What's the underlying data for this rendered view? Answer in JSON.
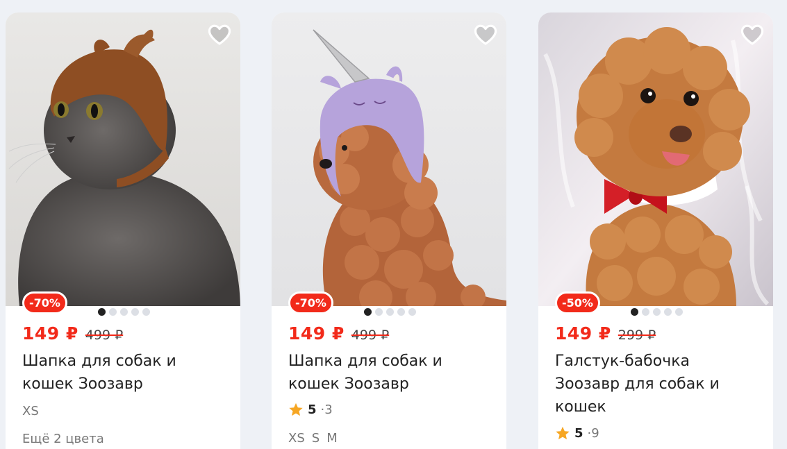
{
  "products": [
    {
      "discount": "-70%",
      "price": "149 ₽",
      "old_price": "499 ₽",
      "title_lines": [
        "Шапка для собак и",
        "кошек Зоозавр"
      ],
      "size": "XS",
      "colors_more": "Ещё 2 цвета",
      "photo_alt": "cat-in-reindeer-hat"
    },
    {
      "discount": "-70%",
      "price": "149 ₽",
      "old_price": "499 ₽",
      "title_lines": [
        "Шапка для собак и",
        "кошек Зоозавр"
      ],
      "rating": "5",
      "rating_sep": "·",
      "reviews": "3",
      "sizes": [
        "XS",
        "S",
        "M"
      ],
      "photo_alt": "poodle-in-unicorn-hat"
    },
    {
      "discount": "-50%",
      "price": "149 ₽",
      "old_price": "299 ₽",
      "title_lines": [
        "Галстук-бабочка",
        "Зоозавр для собак и",
        "кошек"
      ],
      "rating": "5",
      "rating_sep": "·",
      "reviews": "9",
      "photo_alt": "poodle-with-red-bowtie"
    }
  ],
  "colors": {
    "accent_red": "#f22a1a",
    "star": "#f6a623",
    "page_bg": "#eef1f6"
  },
  "icons": {
    "favorite": "heart-outline-icon",
    "rating": "star-icon"
  },
  "gallery": {
    "dot_count": 5,
    "active_index": 0
  }
}
